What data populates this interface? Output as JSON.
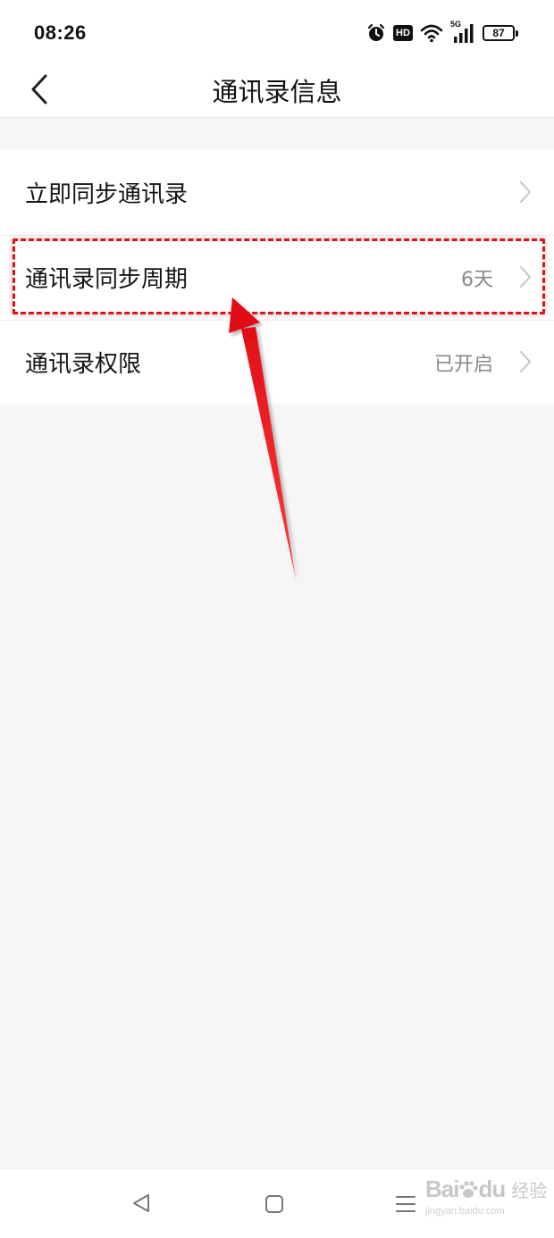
{
  "status_bar": {
    "time": "08:26",
    "network": "5G",
    "hd": "HD",
    "battery": "87"
  },
  "header": {
    "title": "通讯录信息"
  },
  "list": {
    "items": [
      {
        "label": "立即同步通讯录",
        "value": ""
      },
      {
        "label": "通讯录同步周期",
        "value": "6天"
      },
      {
        "label": "通讯录权限",
        "value": "已开启"
      }
    ]
  },
  "watermark": {
    "brand": "Bai",
    "brand2": "du",
    "sub": "经验",
    "url": "jingyan.baidu.com"
  },
  "colors": {
    "annotation": "#d4151d",
    "background": "#f6f6f6",
    "muted_text": "#888888"
  },
  "icons": [
    "alarm-icon",
    "wifi-icon",
    "signal-icon",
    "battery-icon",
    "back-arrow-icon",
    "chevron-right-icon",
    "nav-back-icon",
    "nav-home-icon",
    "nav-menu-icon"
  ]
}
